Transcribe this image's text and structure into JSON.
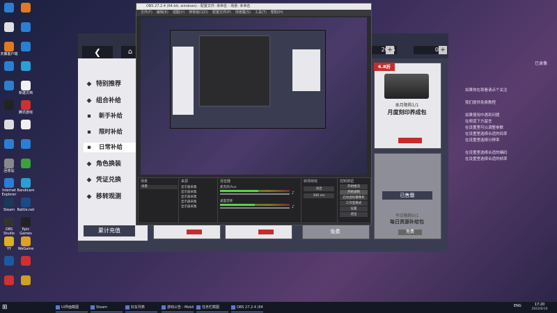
{
  "desktop": {
    "icons": [
      {
        "label": "",
        "color": "#2a7fd4"
      },
      {
        "label": "",
        "color": "#e07a20"
      },
      {
        "label": "",
        "color": "#e0e0e0"
      },
      {
        "label": "",
        "color": "#2a7fd4"
      },
      {
        "label": "天翼客户端",
        "color": "#e07a20"
      },
      {
        "label": "",
        "color": "#2a7fd4"
      },
      {
        "label": "",
        "color": "#2a7fd4"
      },
      {
        "label": "",
        "color": "#2a9fd4"
      },
      {
        "label": "",
        "color": "#2a7fd4"
      },
      {
        "label": "新建文档",
        "color": "#f0f0f0"
      },
      {
        "label": "",
        "color": "#222"
      },
      {
        "label": "腾讯游戏",
        "color": "#d03030"
      },
      {
        "label": "",
        "color": "#ddd"
      },
      {
        "label": "",
        "color": "#f0f0f0"
      },
      {
        "label": "",
        "color": "#2a7fd4"
      },
      {
        "label": "",
        "color": "#2a7fd4"
      },
      {
        "label": "回收站",
        "color": "#888"
      },
      {
        "label": "",
        "color": "#3aa040"
      },
      {
        "label": "Internet Explorer",
        "color": "#2a7fd4"
      },
      {
        "label": "Bandicam",
        "color": "#2a9fd4"
      },
      {
        "label": "Steam",
        "color": "#1a3a5a"
      },
      {
        "label": "Battle.net",
        "color": "#1a4a8a"
      },
      {
        "label": "OBS Studio",
        "color": "#333"
      },
      {
        "label": "Epic Games",
        "color": "#222"
      },
      {
        "label": "YY",
        "color": "#e0b020"
      },
      {
        "label": "WeGame",
        "color": "#e0a020"
      },
      {
        "label": "",
        "color": "#1a5aa0"
      },
      {
        "label": "",
        "color": "#d03030"
      },
      {
        "label": "",
        "color": "#d03030"
      },
      {
        "label": "",
        "color": "#d0a020"
      }
    ]
  },
  "game": {
    "back_icon": "back-arrow-icon",
    "home_icon": "home-icon",
    "menu": [
      {
        "label": "特别推荐",
        "icon": "star-icon"
      },
      {
        "label": "组合补给",
        "icon": "gift-icon"
      },
      {
        "label": "新手补给",
        "icon": "dot-icon"
      },
      {
        "label": "限时补给",
        "icon": "dot-icon"
      },
      {
        "label": "日常补给",
        "icon": "dot-icon"
      },
      {
        "label": "角色换装",
        "icon": "outfit-icon"
      },
      {
        "label": "凭证兑换",
        "icon": "ticket-icon"
      },
      {
        "label": "移转观测",
        "icon": "transfer-icon"
      }
    ],
    "bottom_button": "累计充值",
    "currency1": "2055",
    "currency2": "0",
    "card_main": {
      "discount": "6.8折",
      "subtitle": "本月限购1/1",
      "title": "月度刻印养成包"
    },
    "card_sold": {
      "sold_label": "已售罄",
      "limit": "今日限购0/1",
      "title": "每日资源补给包"
    },
    "bottom_cards": [
      {
        "label": "免费"
      },
      {
        "label": "免费"
      },
      {
        "label": "免费"
      }
    ]
  },
  "obs": {
    "title": "OBS 27.2.4 (64-bit, windows) - 配置文件: 未命名 - 场景: 未命名",
    "menu": [
      "文件(F)",
      "编辑(E)",
      "视图(V)",
      "停靠窗口(D)",
      "配置文件(P)",
      "场景集(S)",
      "工具(T)",
      "帮助(H)"
    ],
    "panels": {
      "scenes": "场景",
      "sources": "来源",
      "mixer": "混音器",
      "transitions": "转场特效",
      "controls": "控制按钮"
    },
    "scene_item": "场景",
    "sources": [
      "显示器采集",
      "显示器采集",
      "显示器采集",
      "显示器采集",
      "显示器采集"
    ],
    "mixer_tracks": [
      {
        "name": "麦克风/Aux",
        "level": 0.55
      },
      {
        "name": "桌面音频",
        "level": 0.5
      }
    ],
    "transition": "淡出",
    "duration": "300 ms",
    "controls": [
      "开始推流",
      "开始录制",
      "启动虚拟摄像机",
      "工作室模式",
      "设置",
      "退出"
    ]
  },
  "right_text": {
    "top_right": "已录像",
    "lines": [
      "如果你在观看请点个关注",
      "",
      "我们提供免费教程",
      "",
      "如果使用中遇到问题",
      "在频道下方留言",
      "在设置里可以调整参数",
      "在设置里选择合适的码率",
      "在设置里选择分辨率",
      "",
      "在设置里选择合适的编码",
      "在设置里选择合适的帧率"
    ]
  },
  "taskbar": {
    "items": [
      {
        "label": "UI界面截图"
      },
      {
        "label": "Steam"
      },
      {
        "label": "好友列表"
      },
      {
        "label": "游戏公告 - Mobile..."
      },
      {
        "label": "任务栏截图"
      },
      {
        "label": "OBS 27.2.4 (64-bit)"
      }
    ],
    "time": "17:20",
    "date": "2022/6/10",
    "lang": "ENG"
  }
}
